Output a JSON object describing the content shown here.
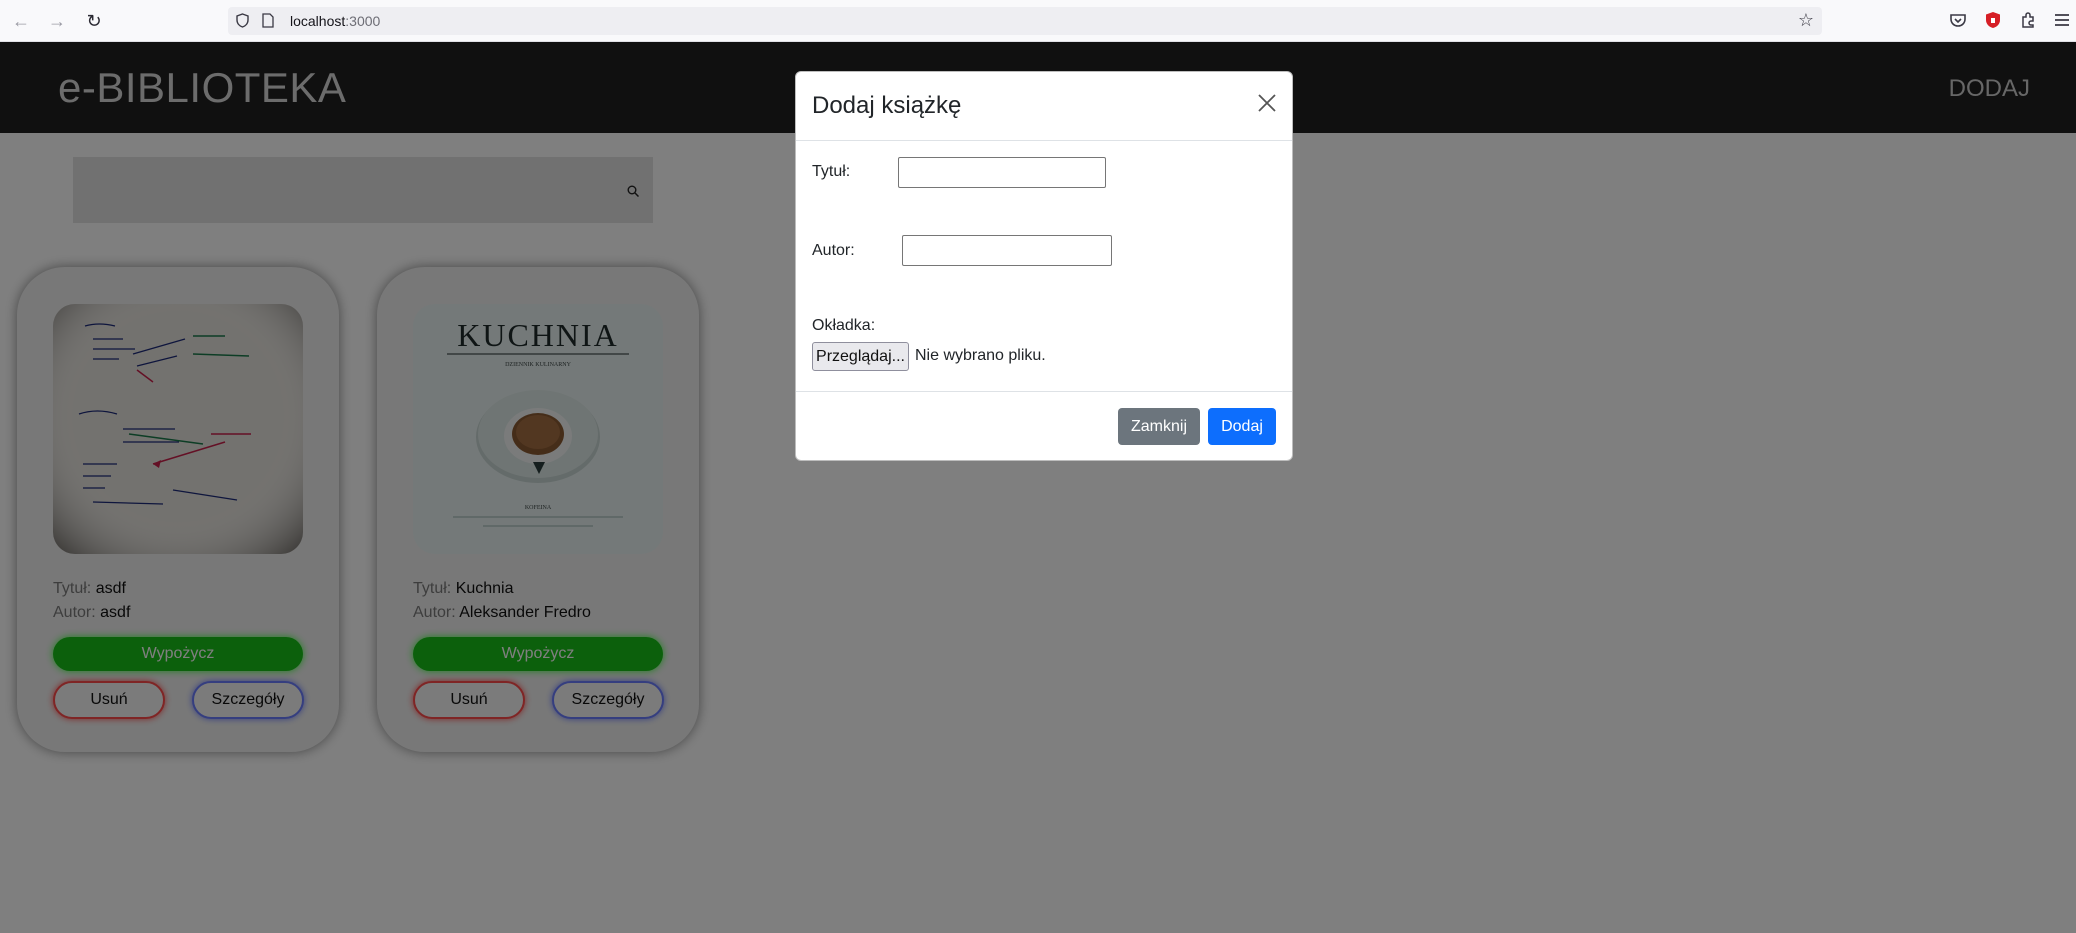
{
  "browser": {
    "url_host": "localhost",
    "url_port": ":3000",
    "icons": [
      "back-icon",
      "forward-icon",
      "reload-icon",
      "shield-icon",
      "page-icon",
      "star-icon",
      "pocket-icon",
      "ublock-icon",
      "extensions-icon",
      "menu-icon"
    ]
  },
  "nav": {
    "brand": "e-BIBLIOTEKA",
    "add_label": "DODAJ"
  },
  "search": {
    "placeholder": ""
  },
  "books": [
    {
      "title_label": "Tytuł:",
      "title": "asdf",
      "author_label": "Autor:",
      "author": "asdf",
      "borrow_label": "Wypożycz",
      "delete_label": "Usuń",
      "details_label": "Szczegóły"
    },
    {
      "cover_title": "KUCHNIA",
      "cover_subtitle": "DZIENNIK KULINARNY",
      "cover_caption": "KOFEINA",
      "title_label": "Tytuł:",
      "title": "Kuchnia",
      "author_label": "Autor:",
      "author": "Aleksander Fredro",
      "borrow_label": "Wypożycz",
      "delete_label": "Usuń",
      "details_label": "Szczegóły"
    }
  ],
  "modal": {
    "title": "Dodaj książkę",
    "title_field_label": "Tytuł:",
    "title_field_value": "",
    "author_field_label": "Autor:",
    "author_field_value": "",
    "cover_field_label": "Okładka:",
    "browse_label": "Przeglądaj...",
    "file_status": "Nie wybrano pliku.",
    "close_label": "Zamknij",
    "add_label": "Dodaj"
  },
  "colors": {
    "navbar": "#212121",
    "borrow": "#19c019",
    "delete_border": "#ff4a4a",
    "details_border": "#6a7cff",
    "close_button": "#6c757d",
    "add_button": "#0d6efd"
  }
}
